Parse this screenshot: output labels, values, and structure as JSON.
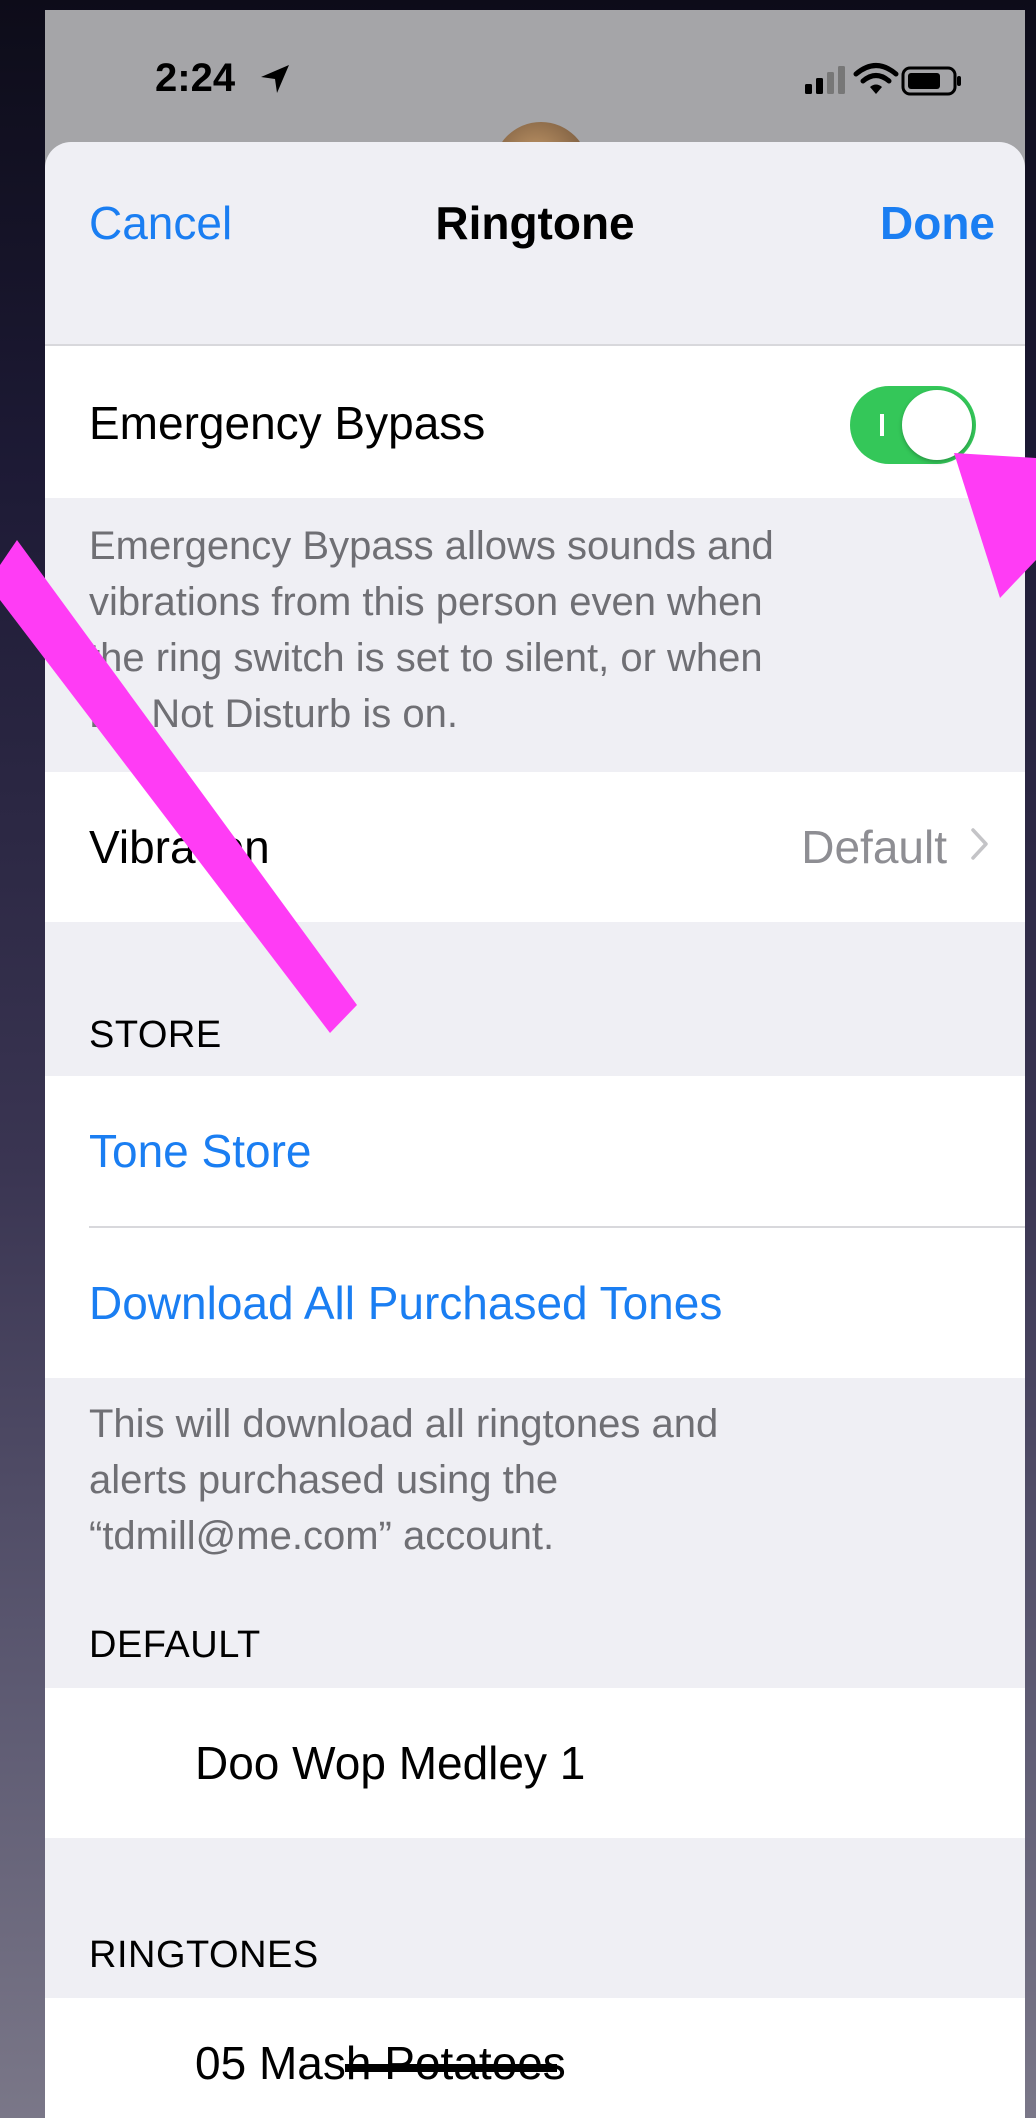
{
  "status_bar": {
    "time": "2:24"
  },
  "nav": {
    "cancel_label": "Cancel",
    "title": "Ringtone",
    "done_label": "Done"
  },
  "emergency_bypass": {
    "label": "Emergency Bypass",
    "enabled": true,
    "footer_lines": [
      "Emergency Bypass allows sounds and",
      "vibrations from this person even when",
      "the ring switch is set to silent, or when",
      "Do Not Disturb is on."
    ]
  },
  "vibration": {
    "label": "Vibration",
    "value": "Default"
  },
  "store": {
    "header": "STORE",
    "tone_store_label": "Tone Store",
    "download_all_label": "Download All Purchased Tones",
    "footer_lines": [
      "This will download all ringtones and",
      "alerts purchased using the",
      "“tdmill@me.com” account."
    ]
  },
  "default_section": {
    "header": "DEFAULT",
    "item": "Doo Wop Medley 1"
  },
  "ringtones_section": {
    "header": "RINGTONES",
    "first_item": "05 Mash Potatoes"
  },
  "colors": {
    "accent_blue": "#1a7ef2",
    "toggle_green": "#34c759",
    "annotation_magenta": "#ff3cf5",
    "grouped_background": "#efeff4"
  },
  "icons": {
    "location": "location-arrow-icon",
    "signal": "cellular-signal-icon",
    "wifi": "wifi-icon",
    "battery": "battery-icon",
    "chevron": "chevron-right-icon"
  }
}
